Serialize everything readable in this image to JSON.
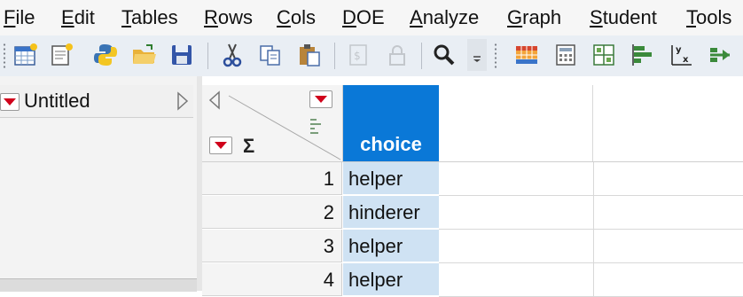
{
  "menu": [
    "File",
    "Edit",
    "Tables",
    "Rows",
    "Cols",
    "DOE",
    "Analyze",
    "Graph",
    "Student",
    "Tools"
  ],
  "left_panel": {
    "title": "Untitled"
  },
  "table": {
    "column_header": "choice",
    "sigma": "Σ",
    "rows": [
      {
        "num": "1",
        "value": "helper"
      },
      {
        "num": "2",
        "value": "hinderer"
      },
      {
        "num": "3",
        "value": "helper"
      },
      {
        "num": "4",
        "value": "helper"
      }
    ]
  },
  "toolbar_icons": [
    "new-data-table-icon",
    "new-script-icon",
    "python-icon",
    "open-folder-icon",
    "save-icon",
    "cut-icon",
    "copy-icon",
    "paste-icon",
    "disabled-format-icon",
    "lock-icon",
    "search-icon",
    "overflow-chevron-icon",
    "data-grid-icon",
    "calculator-icon",
    "layout-grid-icon",
    "bar-chart-icon",
    "fit-yx-icon",
    "pipeline-icon"
  ],
  "colors": {
    "selected_column": "#0a78d7",
    "selected_cells": "#cfe2f3",
    "dropdown_red": "#d0021b"
  }
}
